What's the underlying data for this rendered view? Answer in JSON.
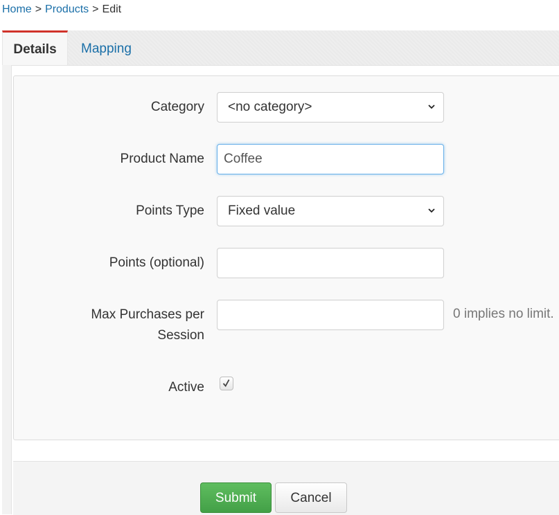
{
  "breadcrumb": {
    "home": "Home",
    "products": "Products",
    "current": "Edit",
    "separator": ">"
  },
  "tabs": [
    {
      "label": "Details",
      "active": true
    },
    {
      "label": "Mapping",
      "active": false
    }
  ],
  "form": {
    "category": {
      "label": "Category",
      "value": "<no category>"
    },
    "product_name": {
      "label": "Product Name",
      "value": "Coffee"
    },
    "points_type": {
      "label": "Points Type",
      "value": "Fixed value"
    },
    "points": {
      "label": "Points (optional)",
      "value": ""
    },
    "max_purchases": {
      "label_line1": "Max Purchases per",
      "label_line2": "Session",
      "value": "",
      "hint": "0 implies no limit."
    },
    "active": {
      "label": "Active",
      "checked": true
    }
  },
  "buttons": {
    "submit": "Submit",
    "cancel": "Cancel"
  },
  "colors": {
    "link": "#1a6fa8",
    "active_tab_accent": "#d0322a",
    "submit_green": "#4cae4c",
    "focus_border": "#66afe9"
  },
  "icons": {
    "select_arrow": "chevron-down-icon",
    "checkmark": "check-icon"
  }
}
